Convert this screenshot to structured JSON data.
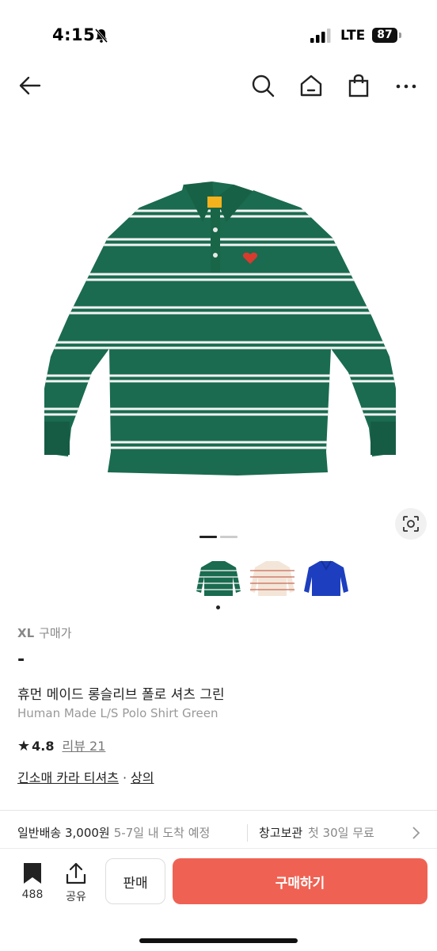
{
  "status_bar": {
    "time": "4:15",
    "network": "LTE",
    "battery": "87"
  },
  "nav": {
    "icons": [
      "back-arrow-icon",
      "search-icon",
      "home-icon",
      "shopping-bag-icon",
      "more-icon"
    ]
  },
  "product": {
    "size_label": "XL",
    "price_label": "구매가",
    "price": "-",
    "name_ko": "휴먼 메이드 롱슬리브 폴로 셔츠 그린",
    "name_en": "Human Made L/S Polo Shirt Green",
    "rating": "4.8",
    "reviews": "리뷰 21",
    "category_1": "긴소매 카라 티셔츠",
    "category_sep": "·",
    "category_2": "상의",
    "colors": {
      "main": "#1a6b4f",
      "stripe": "#ffffff",
      "accent": "#ef6253"
    }
  },
  "gallery": {
    "current_page": 1,
    "total_pages": 2,
    "thumbnails": [
      "green",
      "beige",
      "blue"
    ]
  },
  "shipping": {
    "title": "일반배송",
    "price": "3,000원",
    "detail": "5-7일 내 도착 예정",
    "storage_title": "창고보관",
    "storage_detail": "첫 30일 무료"
  },
  "bottom": {
    "save_count": "488",
    "share_label": "공유",
    "sell_label": "판매",
    "buy_label": "구매하기"
  }
}
